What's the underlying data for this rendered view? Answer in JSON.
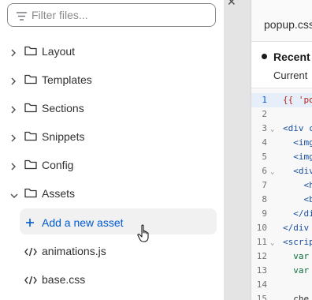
{
  "search": {
    "placeholder": "Filter files..."
  },
  "tree": {
    "folders": [
      {
        "label": "Layout",
        "expanded": false
      },
      {
        "label": "Templates",
        "expanded": false
      },
      {
        "label": "Sections",
        "expanded": false
      },
      {
        "label": "Snippets",
        "expanded": false
      },
      {
        "label": "Config",
        "expanded": false
      },
      {
        "label": "Assets",
        "expanded": true
      }
    ],
    "add_asset_label": "Add a new asset",
    "assets": [
      {
        "label": "animations.js",
        "icon": "code-icon"
      },
      {
        "label": "base.css",
        "icon": "code-icon"
      }
    ]
  },
  "editor": {
    "tab_label": "popup.css",
    "notice_title": "Recent",
    "notice_sub": "Current",
    "lines": [
      {
        "num": "1",
        "text": "{{ 'po",
        "fold": ""
      },
      {
        "num": "2",
        "text": "",
        "fold": ""
      },
      {
        "num": "3",
        "text": "<div c",
        "fold": "⌄"
      },
      {
        "num": "4",
        "text": "  <img",
        "fold": ""
      },
      {
        "num": "5",
        "text": "  <img",
        "fold": ""
      },
      {
        "num": "6",
        "text": "  <div",
        "fold": "⌄"
      },
      {
        "num": "7",
        "text": "    <h",
        "fold": ""
      },
      {
        "num": "8",
        "text": "    <b",
        "fold": ""
      },
      {
        "num": "9",
        "text": "  </di",
        "fold": ""
      },
      {
        "num": "10",
        "text": "</div",
        "fold": ""
      },
      {
        "num": "11",
        "text": "<scrip",
        "fold": "⌄"
      },
      {
        "num": "12",
        "text": "  var",
        "fold": ""
      },
      {
        "num": "13",
        "text": "  var",
        "fold": ""
      },
      {
        "num": "14",
        "text": "",
        "fold": ""
      },
      {
        "num": "15",
        "text": "  che",
        "fold": ""
      }
    ]
  },
  "colors": {
    "link": "#005bd3",
    "hover_bg": "#f1f1f1"
  }
}
